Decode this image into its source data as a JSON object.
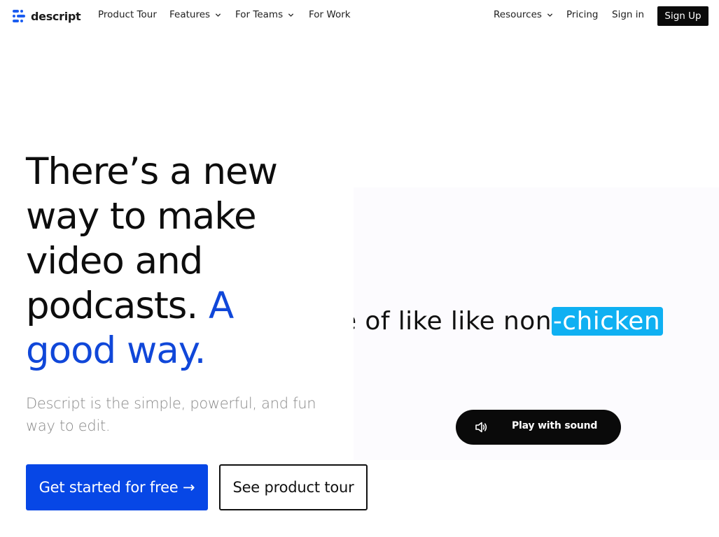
{
  "nav": {
    "logo_text": "descript",
    "items": [
      {
        "label": "Product Tour",
        "has_dropdown": false
      },
      {
        "label": "Features",
        "has_dropdown": true
      },
      {
        "label": "For Teams",
        "has_dropdown": true
      },
      {
        "label": "For Work",
        "has_dropdown": false
      }
    ],
    "right_items": [
      {
        "label": "Resources",
        "has_dropdown": true
      },
      {
        "label": "Pricing",
        "has_dropdown": false
      },
      {
        "label": "Sign in",
        "has_dropdown": false
      }
    ],
    "signup_label": "Sign Up"
  },
  "hero": {
    "headline_main": "There’s a new way to make video and podcasts.",
    "headline_accent": "A good way.",
    "subheadline": "Descript is the simple, powerful, and fun way to edit.",
    "primary_cta": "Get started for free →",
    "secondary_cta": "See product tour"
  },
  "video": {
    "transcript_text": "e of like like non",
    "transcript_highlight": "-chicken",
    "play_label": "Play with sound",
    "play_icon": "speaker-icon"
  },
  "colors": {
    "accent_blue": "#1047d9",
    "cta_blue": "#0747e6",
    "highlight_cyan": "#0fb0f2",
    "logo_blue": "#1a5cf0",
    "black": "#0a0a0a"
  }
}
